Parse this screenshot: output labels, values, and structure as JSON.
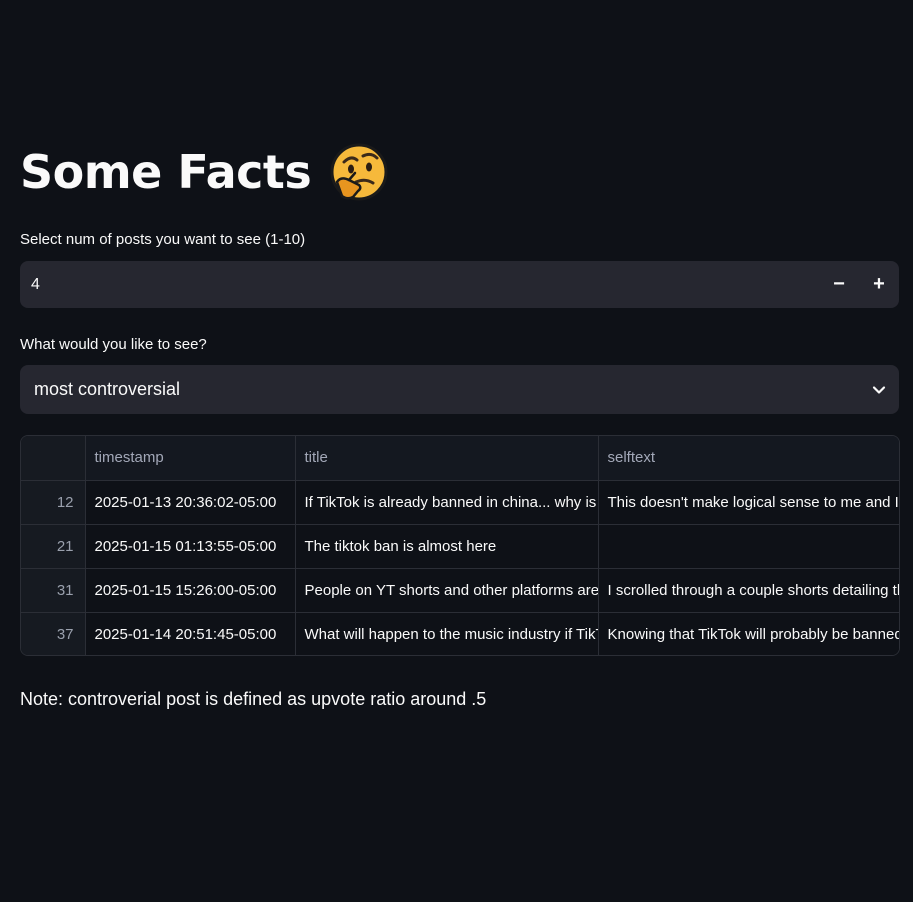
{
  "header": {
    "title": "Some Facts",
    "emoji_icon": "thinking-face-emoji"
  },
  "num_posts": {
    "label": "Select num of posts you want to see (1-10)",
    "value": "4",
    "minus_label": "−",
    "plus_label": "+"
  },
  "view_select": {
    "label": "What would you like to see?",
    "selected": "most controversial"
  },
  "table": {
    "columns": [
      "",
      "timestamp",
      "title",
      "selftext"
    ],
    "rows": [
      {
        "index": "12",
        "timestamp": "2025-01-13 20:36:02-05:00",
        "title": "If TikTok is already banned in china... why is it being banned in the US",
        "selftext": "This doesn't make logical sense to me and I don't understand"
      },
      {
        "index": "21",
        "timestamp": "2025-01-15 01:13:55-05:00",
        "title": "The tiktok ban is almost here",
        "selftext": ""
      },
      {
        "index": "31",
        "timestamp": "2025-01-15 15:26:00-05:00",
        "title": "People on YT shorts and other platforms are saying",
        "selftext": "I scrolled through a couple shorts detailing the ban"
      },
      {
        "index": "37",
        "timestamp": "2025-01-14 20:51:45-05:00",
        "title": "What will happen to the music industry if TikTok is banned",
        "selftext": "Knowing that TikTok will probably be banned soon"
      }
    ]
  },
  "note": "Note: controverial post is defined as upvote ratio around .5",
  "colors": {
    "background": "#0e1117",
    "widget_bg": "#262730",
    "text": "#fafafa",
    "muted": "#a3a8b8"
  }
}
